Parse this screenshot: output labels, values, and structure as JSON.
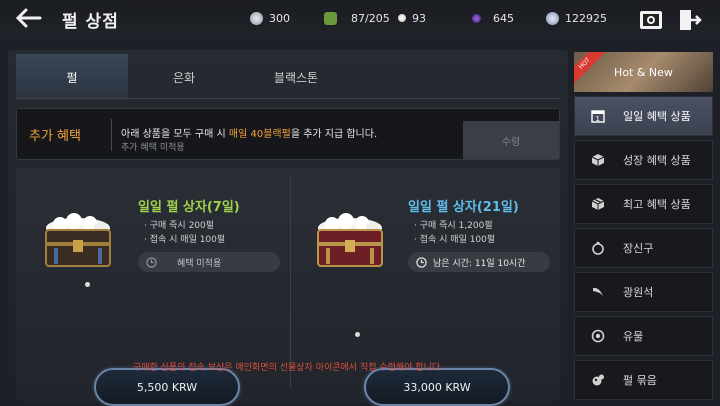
{
  "header": {
    "title": "펄 상점",
    "currencies": [
      {
        "icon": "silver-coin-icon",
        "value": "300",
        "color": "#b8bfc7"
      },
      {
        "icon": "stamina-icon",
        "value": "87/205",
        "color": "#7fae4a"
      },
      {
        "icon": "pearl-icon",
        "value": "93",
        "color": "#e8e2da"
      },
      {
        "icon": "black-stone-icon",
        "value": "645",
        "color": "#6b3bb8"
      },
      {
        "icon": "silver-icon",
        "value": "122925",
        "color": "#a9b8d6"
      }
    ]
  },
  "tabs": [
    "펄",
    "은화",
    "블랙스톤"
  ],
  "bonus": {
    "label": "추가 혜택",
    "msg_prefix": "아래 상품을 모두 구매 시 ",
    "msg_highlight": "매일 40블랙펄",
    "msg_suffix": "을 추가 지급 합니다.",
    "sub": "추가 혜택 미적용",
    "button": "수령"
  },
  "products": [
    {
      "name": "일일 펄 상자(7일)",
      "lines": [
        "· 구매 즉시 200펄",
        "· 접속 시 매일 100펄"
      ],
      "status": "혜택 미적용",
      "price": "5,500 KRW"
    },
    {
      "name": "일일 펄 상자(21일)",
      "lines": [
        "· 구매 즉시 1,200펄",
        "· 접속 시 매일 100펄"
      ],
      "status": "남은 시간: 11일 10시간",
      "price": "33,000 KRW"
    }
  ],
  "notice": "구매한 상품의 접속 보상은 메인화면의 선물상자 아이콘에서 직접 수령해야 합니다.",
  "sidebar": {
    "hot": {
      "ribbon": "HOT",
      "label": "Hot & New"
    },
    "items": [
      {
        "label": "일일 혜택 상품",
        "icon": "calendar-icon"
      },
      {
        "label": "성장 혜택 상품",
        "icon": "box-icon"
      },
      {
        "label": "최고 혜택 상품",
        "icon": "gift-box-icon"
      },
      {
        "label": "장신구",
        "icon": "ring-icon"
      },
      {
        "label": "광원석",
        "icon": "crystal-icon"
      },
      {
        "label": "유물",
        "icon": "relic-icon"
      },
      {
        "label": "펄 묶음",
        "icon": "pearl-bundle-icon"
      }
    ]
  }
}
